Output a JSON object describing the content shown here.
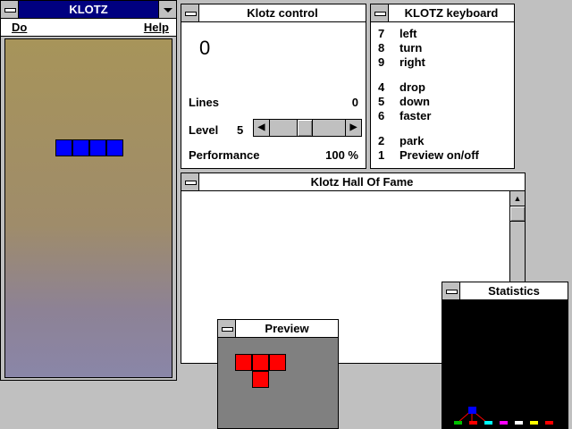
{
  "klotz_window": {
    "title": "KLOTZ",
    "menu": [
      "Do",
      "Help"
    ],
    "falling_piece_color": "#0000ff",
    "falling_piece_blocks": 4
  },
  "control_window": {
    "title": "Klotz control",
    "score": "0",
    "lines_label": "Lines",
    "lines_value": "0",
    "level_label": "Level",
    "level_value": "5",
    "level_fraction": 0.45,
    "performance_label": "Performance",
    "performance_value": "100 %"
  },
  "keyboard_window": {
    "title": "KLOTZ keyboard",
    "keys": [
      {
        "key": "7",
        "action": "left"
      },
      {
        "key": "8",
        "action": "turn"
      },
      {
        "key": "9",
        "action": "right"
      },
      {
        "key": "4",
        "action": "drop"
      },
      {
        "key": "5",
        "action": "down"
      },
      {
        "key": "6",
        "action": "faster"
      },
      {
        "key": "2",
        "action": "park"
      },
      {
        "key": "1",
        "action": "Preview on/off"
      }
    ]
  },
  "hall_window": {
    "title": "Klotz Hall Of Fame"
  },
  "preview_window": {
    "title": "Preview",
    "piece_color": "#ff0000",
    "piece_shape": "T"
  },
  "stats_window": {
    "title": "Statistics",
    "bar_colors": [
      "#00c000",
      "#ff0000",
      "#00ffff",
      "#ff00ff",
      "#ffffff",
      "#ffff00",
      "#ff0000"
    ],
    "highlight_color": "#0000ff"
  }
}
